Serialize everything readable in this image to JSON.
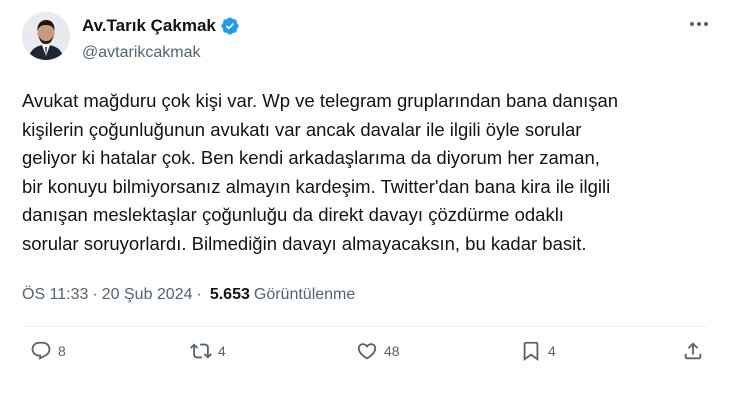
{
  "user": {
    "display_name": "Av.Tarık Çakmak",
    "handle": "@avtarikcakmak",
    "verified": true
  },
  "tweet": {
    "lines": [
      "Avukat mağduru çok kişi var. Wp ve telegram gruplarından bana danışan",
      "kişilerin çoğunluğunun avukatı var ancak davalar ile ilgili öyle sorular",
      "geliyor ki hatalar çok. Ben kendi arkadaşlarıma da diyorum her zaman,",
      "bir konuyu bilmiyorsanız almayın kardeşim. Twitter'dan bana kira ile ilgili",
      "danışan meslektaşlar çoğunluğu da direkt davayı çözdürme odaklı",
      "sorular soruyorlardı. Bilmediğin davayı almayacaksın, bu kadar basit."
    ],
    "time": "ÖS 11:33",
    "separator": "·",
    "date": "20 Şub 2024",
    "views_count": "5.653",
    "views_label": "Görüntülenme"
  },
  "actions": {
    "replies": "8",
    "retweets": "4",
    "likes": "48",
    "bookmarks": "4"
  },
  "colors": {
    "text": "#0f1419",
    "secondary": "#536471",
    "verified": "#1d9bf0"
  }
}
